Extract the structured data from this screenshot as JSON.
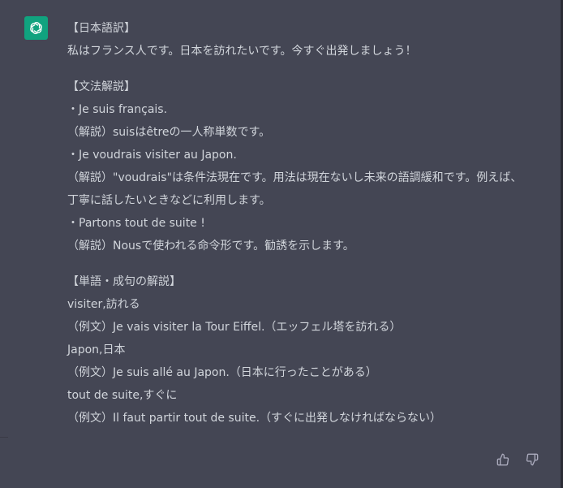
{
  "message": {
    "sections": [
      {
        "lines": [
          "【日本語訳】",
          "私はフランス人です。日本を訪れたいです。今すぐ出発しましょう！"
        ]
      },
      {
        "lines": [
          "【文法解説】",
          "・Je suis français.",
          "（解説）suisはêtreの一人称単数です。",
          "・Je voudrais visiter au Japon.",
          "（解説）\"voudrais\"は条件法現在です。用法は現在ないし未来の語調緩和です。例えば、",
          "丁寧に話したいときなどに利用します。",
          "・Partons tout de suite !",
          "（解説）Nousで使われる命令形です。勧誘を示します。"
        ]
      },
      {
        "lines": [
          "【単語・成句の解説】",
          "visiter,訪れる",
          "（例文）Je vais visiter la Tour Eiffel.（エッフェル塔を訪れる）",
          "Japon,日本",
          "（例文）Je suis allé au Japon.（日本に行ったことがある）",
          "tout de suite,すぐに",
          "（例文）Il faut partir tout de suite.（すぐに出発しなければならない）"
        ]
      }
    ]
  },
  "avatar": {
    "icon": "openai-logo-icon",
    "bg_color": "#10a37f"
  },
  "actions": {
    "thumbs_up_icon": "thumbs-up-icon",
    "thumbs_down_icon": "thumbs-down-icon"
  },
  "colors": {
    "background": "#444654",
    "text": "#d1d5db",
    "icon": "#acacbe"
  }
}
